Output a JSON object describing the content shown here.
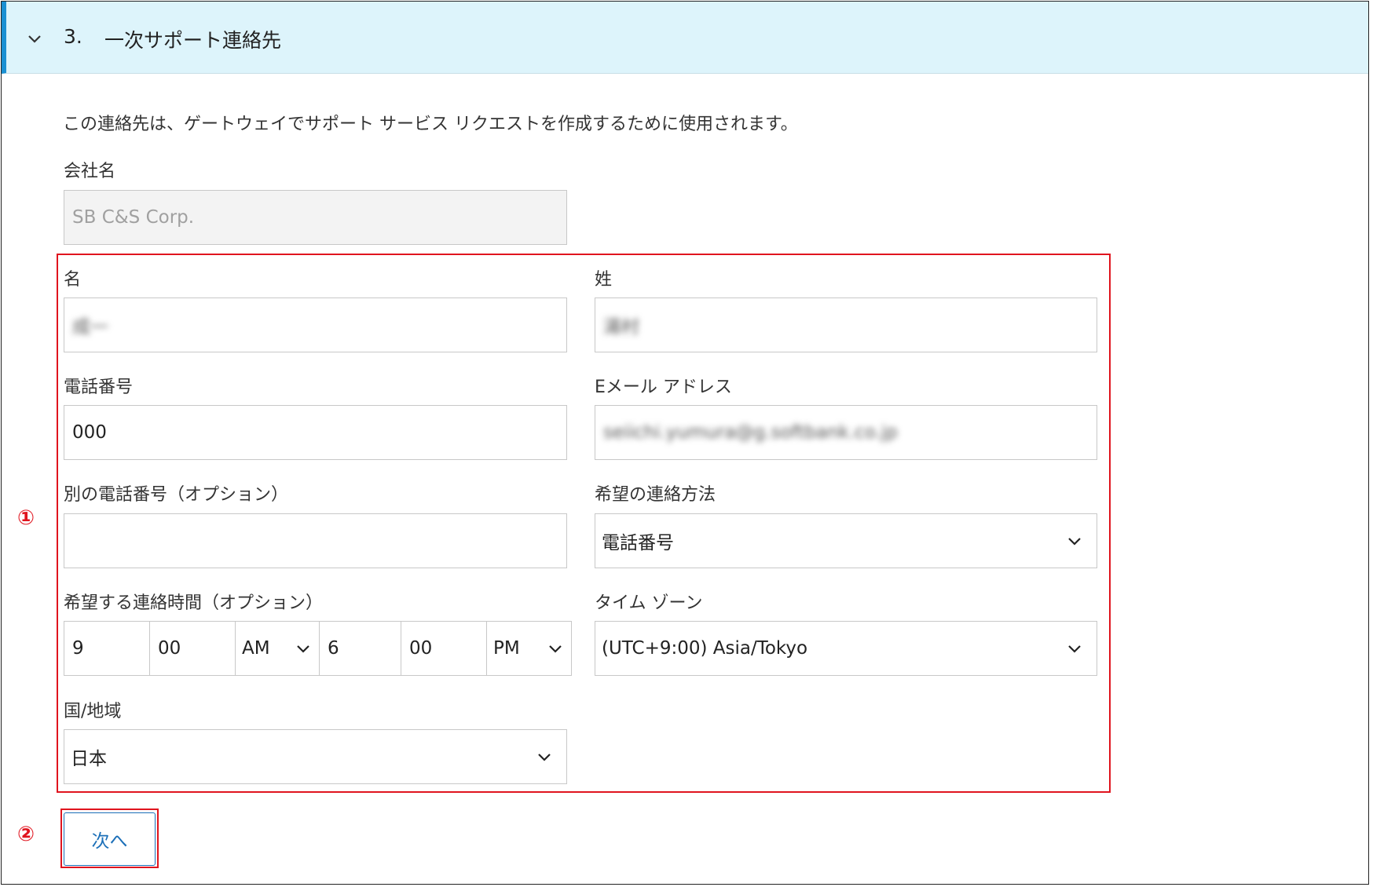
{
  "section": {
    "number": "3.",
    "title": "一次サポート連絡先"
  },
  "description": "この連絡先は、ゲートウェイでサポート サービス リクエストを作成するために使用されます。",
  "company": {
    "label": "会社名",
    "value": "SB C&S Corp."
  },
  "first_name": {
    "label": "名",
    "value": "成一"
  },
  "last_name": {
    "label": "姓",
    "value": "湯村"
  },
  "phone": {
    "label": "電話番号",
    "value": "000"
  },
  "email": {
    "label": "Eメール アドレス",
    "value": "seiichi.yumura@g.softbank.co.jp"
  },
  "alt_phone": {
    "label": "別の電話番号（オプション）",
    "value": ""
  },
  "contact_method": {
    "label": "希望の連絡方法",
    "value": "電話番号"
  },
  "contact_time": {
    "label": "希望する連絡時間（オプション）",
    "from_hour": "9",
    "from_min": "00",
    "from_ampm": "AM",
    "to_hour": "6",
    "to_min": "00",
    "to_ampm": "PM"
  },
  "timezone": {
    "label": "タイム ゾーン",
    "value": "(UTC+9:00) Asia/Tokyo"
  },
  "country": {
    "label": "国/地域",
    "value": "日本"
  },
  "next_button": "次へ",
  "annotations": {
    "marker1": "①",
    "marker2": "②"
  },
  "colors": {
    "header_bg": "#ddf4fb",
    "accent": "#1b90d2",
    "annotation_red": "#e0141e",
    "button_blue": "#1b6fb8"
  },
  "icons": {
    "header": "chevron-down-icon",
    "select": "chevron-down-icon"
  }
}
